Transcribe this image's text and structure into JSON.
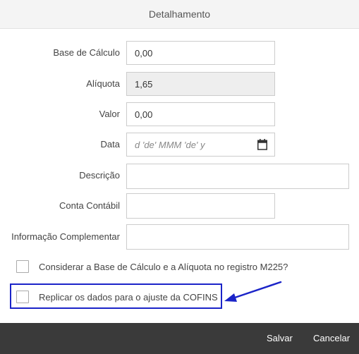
{
  "header": {
    "title": "Detalhamento"
  },
  "form": {
    "base_calculo": {
      "label": "Base de Cálculo",
      "value": "0,00"
    },
    "aliquota": {
      "label": "Alíquota",
      "value": "1,65"
    },
    "valor": {
      "label": "Valor",
      "value": "0,00"
    },
    "data": {
      "label": "Data",
      "placeholder": "d 'de' MMM 'de' y"
    },
    "descricao": {
      "label": "Descrição",
      "value": ""
    },
    "conta_contabil": {
      "label": "Conta Contábil",
      "value": ""
    },
    "informacao_complementar": {
      "label": "Informação Complementar",
      "value": ""
    }
  },
  "checkboxes": {
    "considerar": {
      "label": "Considerar a Base de Cálculo e a Alíquota no registro M225?",
      "checked": false
    },
    "replicar": {
      "label": "Replicar os dados para o ajuste da COFINS",
      "checked": false
    }
  },
  "annotation": {
    "color": "#1b24c8"
  },
  "footer": {
    "save_label": "Salvar",
    "cancel_label": "Cancelar"
  }
}
